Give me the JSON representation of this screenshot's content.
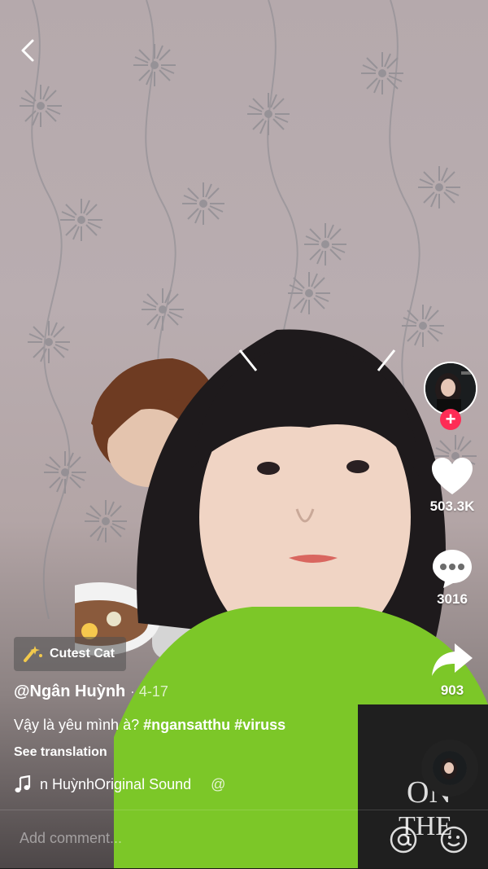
{
  "effect": {
    "icon": "sparkle-effect-icon",
    "label": "Cutest Cat"
  },
  "author": {
    "handle": "@Ngân Huỳnh",
    "date": "4-17"
  },
  "caption": {
    "text": "Vậy là yêu mình à?",
    "hashtags": [
      "#ngansatthu",
      "#viruss"
    ]
  },
  "see_translation": "See translation",
  "music": {
    "icon": "music-note-icon",
    "text": "n HuỳnhOriginal Sound",
    "at": "@"
  },
  "actions": {
    "likes": "503.3K",
    "comments": "3016",
    "shares": "903"
  },
  "follow_symbol": "+",
  "comment_bar": {
    "placeholder": "Add comment..."
  },
  "colors": {
    "accent": "#fe2c55",
    "sweater": "#7cc728"
  }
}
